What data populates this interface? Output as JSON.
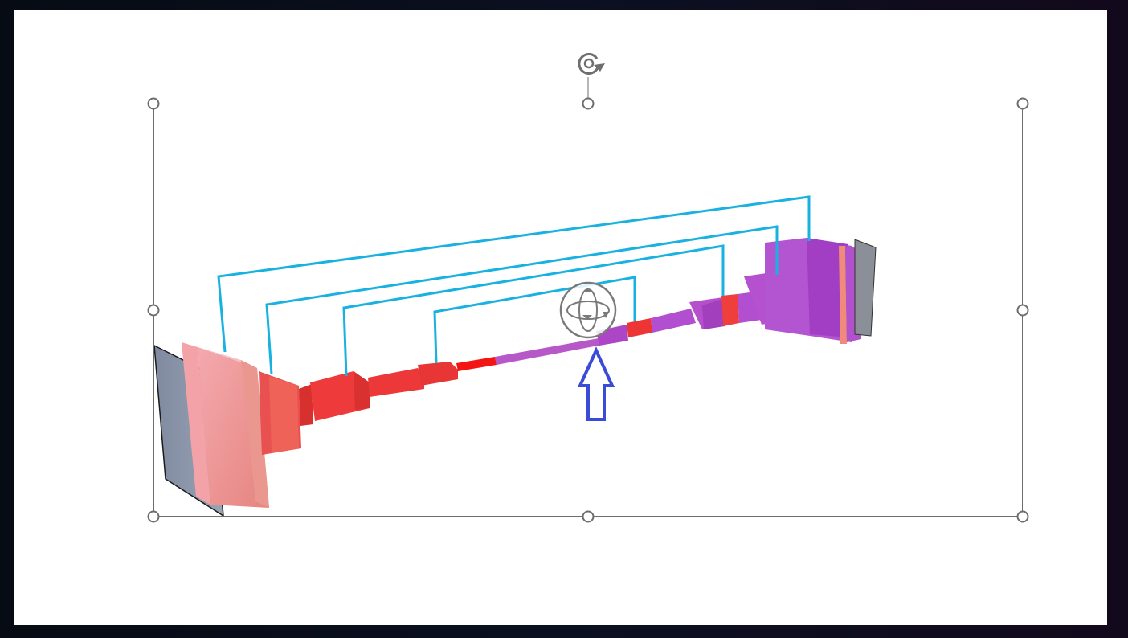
{
  "slide": {
    "background": "#ffffff",
    "object": {
      "type": "3d-model",
      "selected": true
    }
  },
  "icons": {
    "rotate_handle": "rotate-handle-icon",
    "orbit_3d": "3d-rotate-icon",
    "annotation_arrow": "up-arrow-icon"
  },
  "colors": {
    "selection_border": "#6e6e6e",
    "connector": "#19b2e0",
    "encoder_red": "#ee3a3a",
    "encoder_pink": "#f08888",
    "decoder_purple": "#b14fd0",
    "input_plane": "#8a95a6",
    "arrow": "#3a4bd8"
  }
}
